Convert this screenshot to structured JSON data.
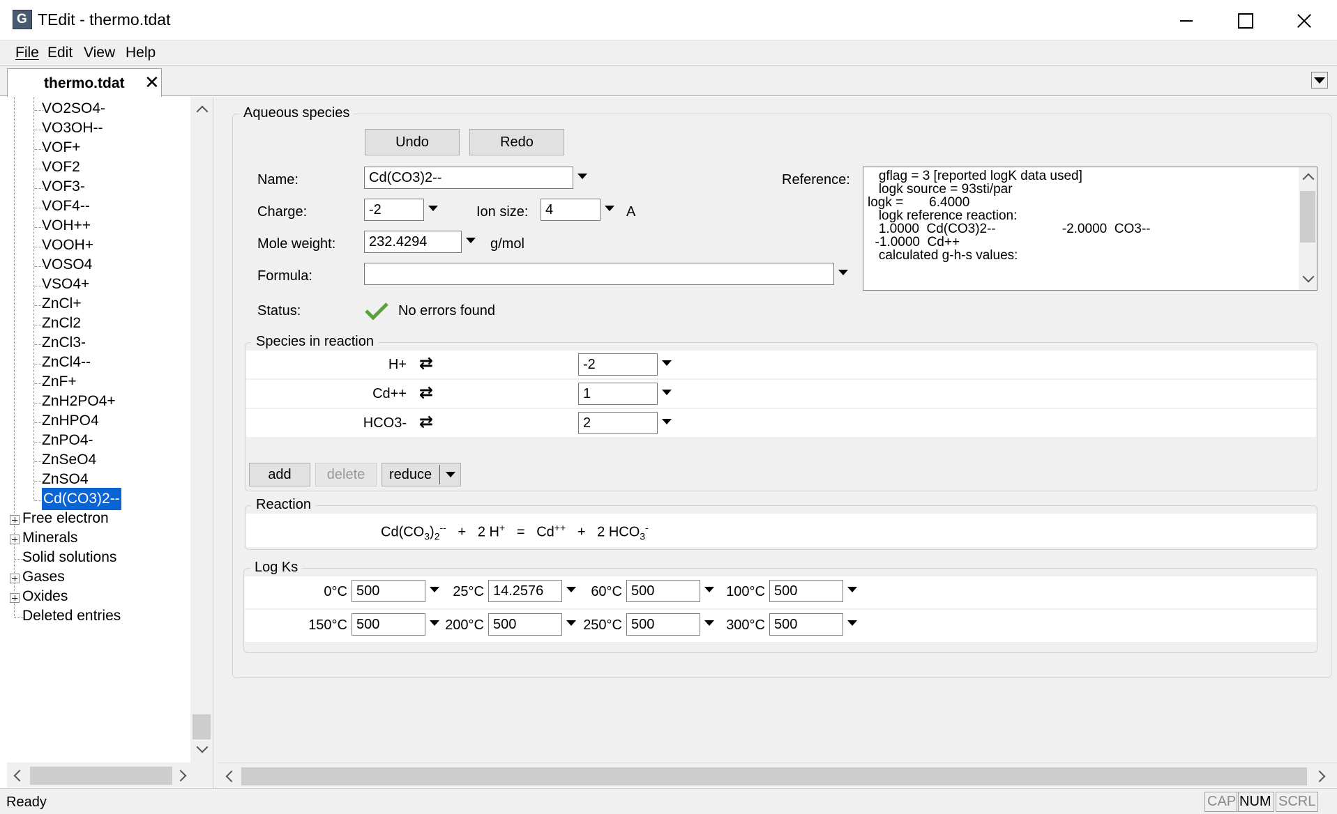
{
  "window": {
    "title": "TEdit - thermo.tdat"
  },
  "menu": {
    "file": "File",
    "edit": "Edit",
    "view": "View",
    "help": "Help"
  },
  "tab": {
    "label": "thermo.tdat"
  },
  "tree": {
    "species": [
      "VO2SO4-",
      "VO3OH--",
      "VOF+",
      "VOF2",
      "VOF3-",
      "VOF4--",
      "VOH++",
      "VOOH+",
      "VOSO4",
      "VSO4+",
      "ZnCl+",
      "ZnCl2",
      "ZnCl3-",
      "ZnCl4--",
      "ZnF+",
      "ZnH2PO4+",
      "ZnHPO4",
      "ZnPO4-",
      "ZnSeO4",
      "ZnSO4",
      "Cd(CO3)2--"
    ],
    "selected": "Cd(CO3)2--",
    "categories": [
      {
        "label": "Free electron",
        "expandable": true
      },
      {
        "label": "Minerals",
        "expandable": true
      },
      {
        "label": "Solid solutions",
        "expandable": false
      },
      {
        "label": "Gases",
        "expandable": true
      },
      {
        "label": "Oxides",
        "expandable": true
      },
      {
        "label": "Deleted entries",
        "expandable": false
      }
    ]
  },
  "aqueous": {
    "group_label": "Aqueous species",
    "undo": "Undo",
    "redo": "Redo",
    "name_label": "Name:",
    "name_value": "Cd(CO3)2--",
    "charge_label": "Charge:",
    "charge_value": "-2",
    "ionsize_label": "Ion size:",
    "ionsize_value": "4",
    "ionsize_unit": "A",
    "moleweight_label": "Mole weight:",
    "moleweight_value": "232.4294",
    "moleweight_unit": "g/mol",
    "formula_label": "Formula:",
    "formula_value": "",
    "status_label": "Status:",
    "status_value": "No errors found",
    "reference_label": "Reference:",
    "reference_lines": [
      "   gflag = 3 [reported logK data used]",
      "   logk source = 93sti/par",
      "logk =       6.4000",
      "   logk reference reaction:",
      "   1.0000  Cd(CO3)2--                  -2.0000  CO3--",
      "  -1.0000  Cd++",
      "   calculated g-h-s values:"
    ]
  },
  "species_in_reaction": {
    "group_label": "Species in reaction",
    "rows": [
      {
        "species": "H+",
        "coef": "-2"
      },
      {
        "species": "Cd++",
        "coef": "1"
      },
      {
        "species": "HCO3-",
        "coef": "2"
      }
    ],
    "add": "add",
    "delete": "delete",
    "reduce": "reduce"
  },
  "reaction": {
    "group_label": "Reaction",
    "lhs_base": "Cd(CO",
    "lhs_sub1": "3",
    "lhs_mid": ")",
    "lhs_sub2": "2",
    "lhs_sup": "--",
    "plus1": "+",
    "term2": "2 H",
    "term2_sup": "+",
    "equals": "=",
    "term3": "Cd",
    "term3_sup": "++",
    "plus2": "+",
    "term4": "2 HCO",
    "term4_sub": "3",
    "term4_sup": "-"
  },
  "logks": {
    "group_label": "Log Ks",
    "row1": [
      {
        "temp": "0°C",
        "value": "500"
      },
      {
        "temp": "25°C",
        "value": "14.2576"
      },
      {
        "temp": "60°C",
        "value": "500"
      },
      {
        "temp": "100°C",
        "value": "500"
      }
    ],
    "row2": [
      {
        "temp": "150°C",
        "value": "500"
      },
      {
        "temp": "200°C",
        "value": "500"
      },
      {
        "temp": "250°C",
        "value": "500"
      },
      {
        "temp": "300°C",
        "value": "500"
      }
    ]
  },
  "statusbar": {
    "text": "Ready",
    "cap": "CAP",
    "num": "NUM",
    "scrl": "SCRL"
  },
  "colors": {
    "selection": "#0a64d4",
    "checkmark": "#5aa23c"
  },
  "icons": [
    "app-icon",
    "close-icon",
    "swap-icon",
    "check-icon",
    "chevron-down-icon"
  ]
}
